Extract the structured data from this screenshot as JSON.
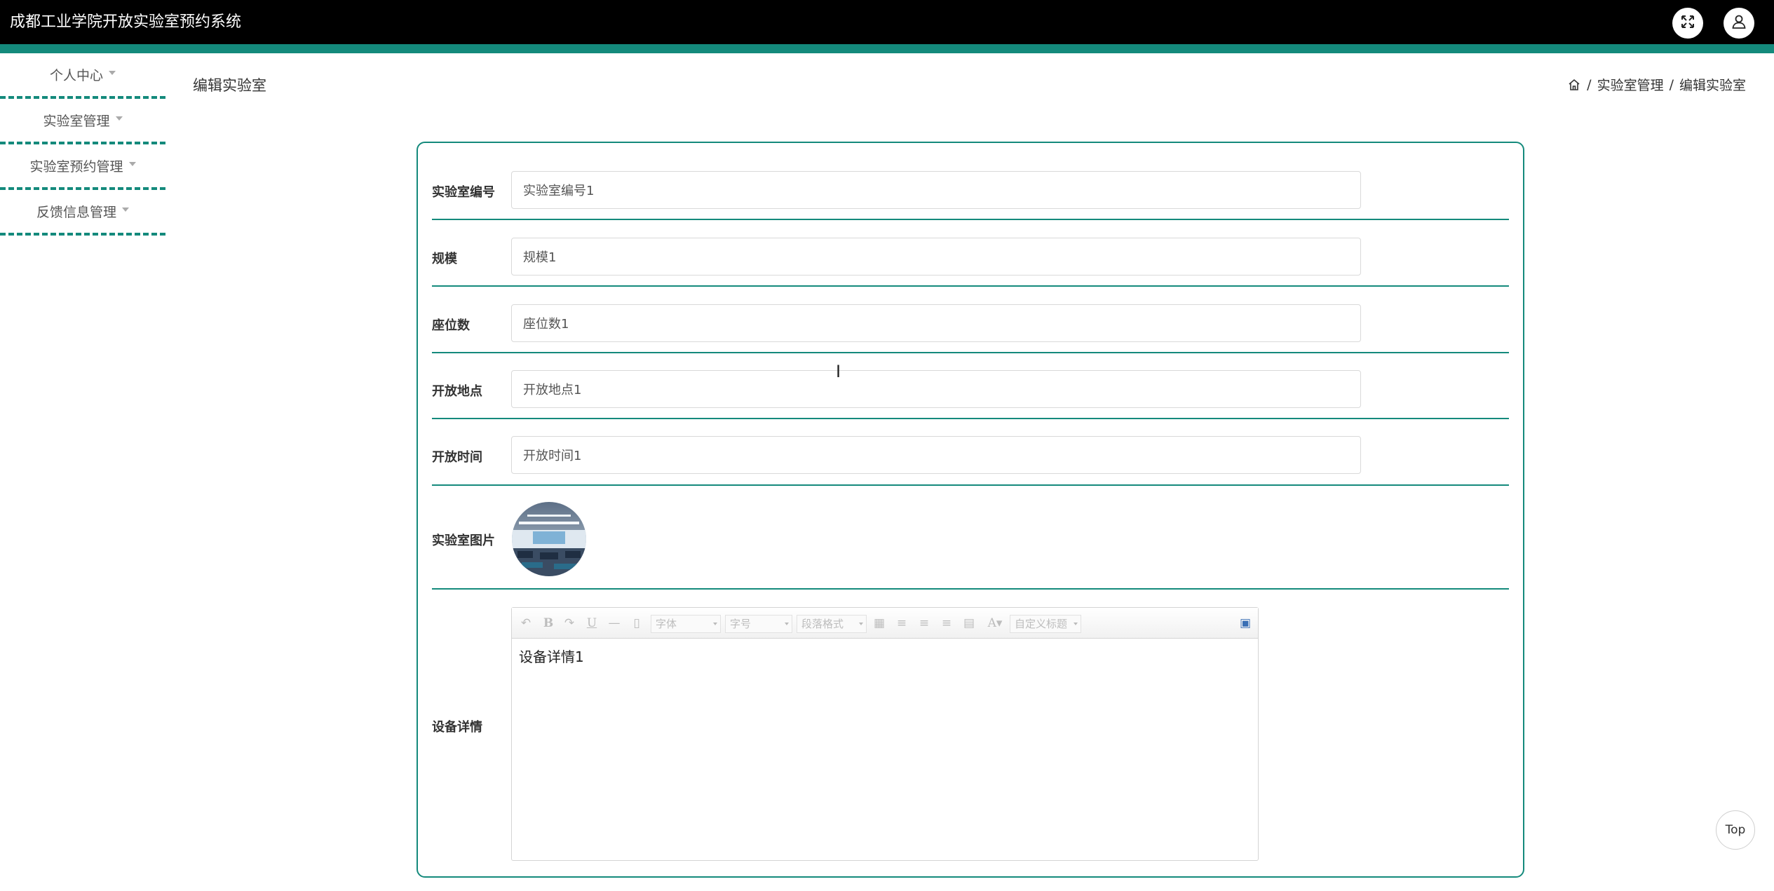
{
  "header": {
    "title": "成都工业学院开放实验室预约系统",
    "fullscreen_icon": "expand-arrows-icon",
    "user_icon": "user-icon"
  },
  "colors": {
    "topbar": "#000000",
    "accent": "#148a7c"
  },
  "sidebar": {
    "items": [
      {
        "label": "个人中心"
      },
      {
        "label": "实验室管理"
      },
      {
        "label": "实验室预约管理"
      },
      {
        "label": "反馈信息管理"
      }
    ]
  },
  "page": {
    "title": "编辑实验室",
    "breadcrumb": {
      "home_icon": "home-icon",
      "separator": "/",
      "items": [
        "实验室管理",
        "编辑实验室"
      ]
    }
  },
  "form": {
    "fields": [
      {
        "label": "实验室编号",
        "value": "实验室编号1"
      },
      {
        "label": "规模",
        "value": "规模1"
      },
      {
        "label": "座位数",
        "value": "座位数1"
      },
      {
        "label": "开放地点",
        "value": "开放地点1"
      },
      {
        "label": "开放时间",
        "value": "开放时间1"
      }
    ],
    "image_label": "实验室图片",
    "detail_label": "设备详情",
    "editor": {
      "font_placeholder": "字体",
      "size_placeholder": "字号",
      "format_placeholder": "段落格式",
      "custom_title_placeholder": "自定义标题",
      "content": "设备详情1"
    }
  },
  "top_button": "Top"
}
